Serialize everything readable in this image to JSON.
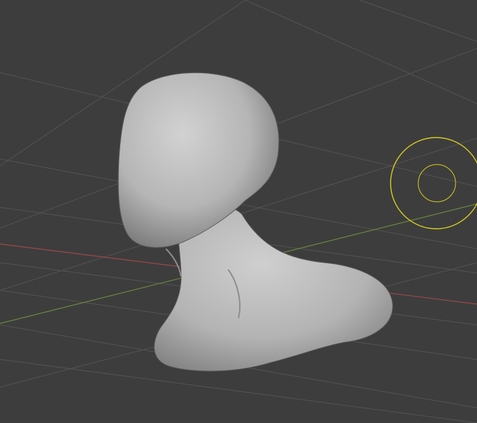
{
  "viewport": {
    "colors": {
      "background": "#3d3d3d",
      "grid": "#555555",
      "x_axis": "#a04848",
      "y_axis": "#6c8a3c",
      "light_gizmo": "#d8d020",
      "mesh": "#b9b9b9"
    }
  }
}
